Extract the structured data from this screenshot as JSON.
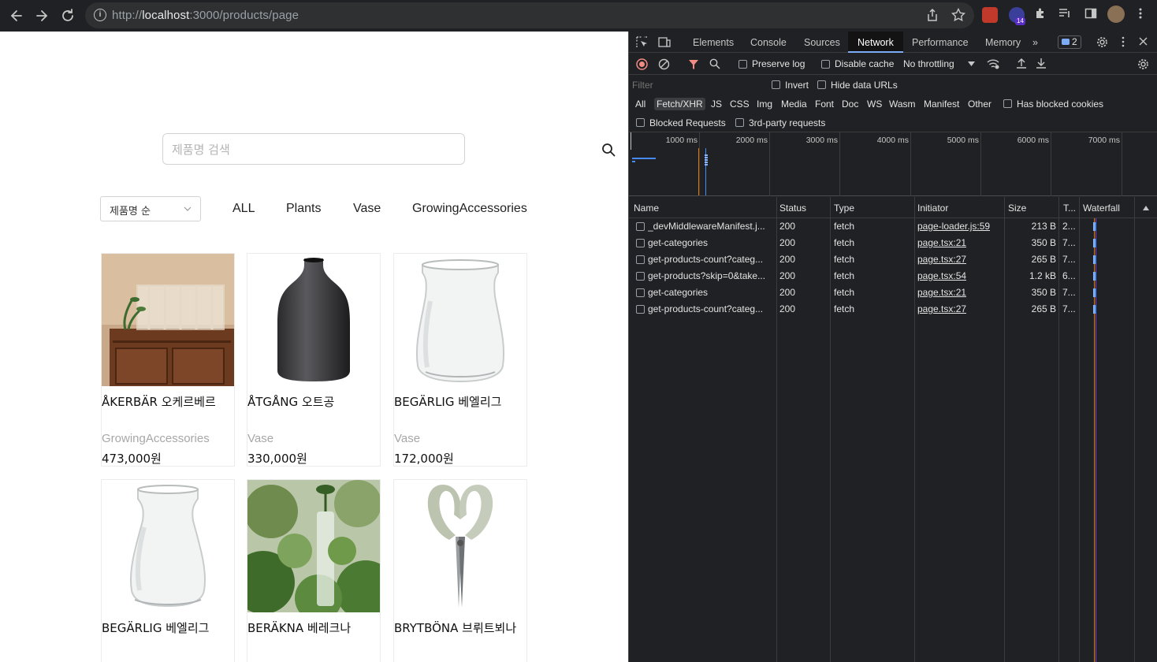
{
  "browser": {
    "url_scheme": "http://",
    "url_host": "localhost",
    "url_rest": ":3000/products/page",
    "extension_badge": "14"
  },
  "page": {
    "search": {
      "placeholder": "제품명 검색"
    },
    "sort": {
      "selected": "제품명 순"
    },
    "categories": [
      "ALL",
      "Plants",
      "Vase",
      "GrowingAccessories"
    ],
    "products": [
      {
        "name": "ÅKERBÄR 오케르베르",
        "category": "GrowingAccessories",
        "price": "473,000원",
        "image": "shelf-photo"
      },
      {
        "name": "ÅTGÅNG 오트공",
        "category": "Vase",
        "price": "330,000원",
        "image": "dark-vase"
      },
      {
        "name": "BEGÄRLIG 베엘리그",
        "category": "Vase",
        "price": "172,000원",
        "image": "glass-jar"
      },
      {
        "name": "BEGÄRLIG 베엘리그",
        "category": "",
        "price": "",
        "image": "glass-jar-tall"
      },
      {
        "name": "BERÄKNA 베레크나",
        "category": "",
        "price": "",
        "image": "plant-photo"
      },
      {
        "name": "BRYTBÖNA 브뤼트뵈나",
        "category": "",
        "price": "",
        "image": "scissors"
      }
    ]
  },
  "devtools": {
    "tabs": [
      "Elements",
      "Console",
      "Sources",
      "Network",
      "Performance",
      "Memory"
    ],
    "active_tab": "Network",
    "issues_count": "2",
    "toolbar": {
      "preserve_log": "Preserve log",
      "disable_cache": "Disable cache",
      "throttling": "No throttling"
    },
    "filter": {
      "placeholder": "Filter",
      "invert": "Invert",
      "hide_data_urls": "Hide data URLs"
    },
    "types": [
      "All",
      "Fetch/XHR",
      "JS",
      "CSS",
      "Img",
      "Media",
      "Font",
      "Doc",
      "WS",
      "Wasm",
      "Manifest",
      "Other"
    ],
    "active_type": "Fetch/XHR",
    "has_blocked_cookies": "Has blocked cookies",
    "blocked_requests": "Blocked Requests",
    "third_party": "3rd-party requests",
    "timeline_labels": [
      "1000 ms",
      "2000 ms",
      "3000 ms",
      "4000 ms",
      "5000 ms",
      "6000 ms",
      "7000 ms"
    ],
    "columns": {
      "name": "Name",
      "status": "Status",
      "type": "Type",
      "initiator": "Initiator",
      "size": "Size",
      "time": "T...",
      "waterfall": "Waterfall"
    },
    "requests": [
      {
        "name": "_devMiddlewareManifest.j...",
        "status": "200",
        "type": "fetch",
        "initiator": "page-loader.js:59",
        "size": "213 B",
        "time": "2..."
      },
      {
        "name": "get-categories",
        "status": "200",
        "type": "fetch",
        "initiator": "page.tsx:21",
        "size": "350 B",
        "time": "7..."
      },
      {
        "name": "get-products-count?categ...",
        "status": "200",
        "type": "fetch",
        "initiator": "page.tsx:27",
        "size": "265 B",
        "time": "7..."
      },
      {
        "name": "get-products?skip=0&take...",
        "status": "200",
        "type": "fetch",
        "initiator": "page.tsx:54",
        "size": "1.2 kB",
        "time": "6..."
      },
      {
        "name": "get-categories",
        "status": "200",
        "type": "fetch",
        "initiator": "page.tsx:21",
        "size": "350 B",
        "time": "7..."
      },
      {
        "name": "get-products-count?categ...",
        "status": "200",
        "type": "fetch",
        "initiator": "page.tsx:27",
        "size": "265 B",
        "time": "7..."
      }
    ]
  }
}
